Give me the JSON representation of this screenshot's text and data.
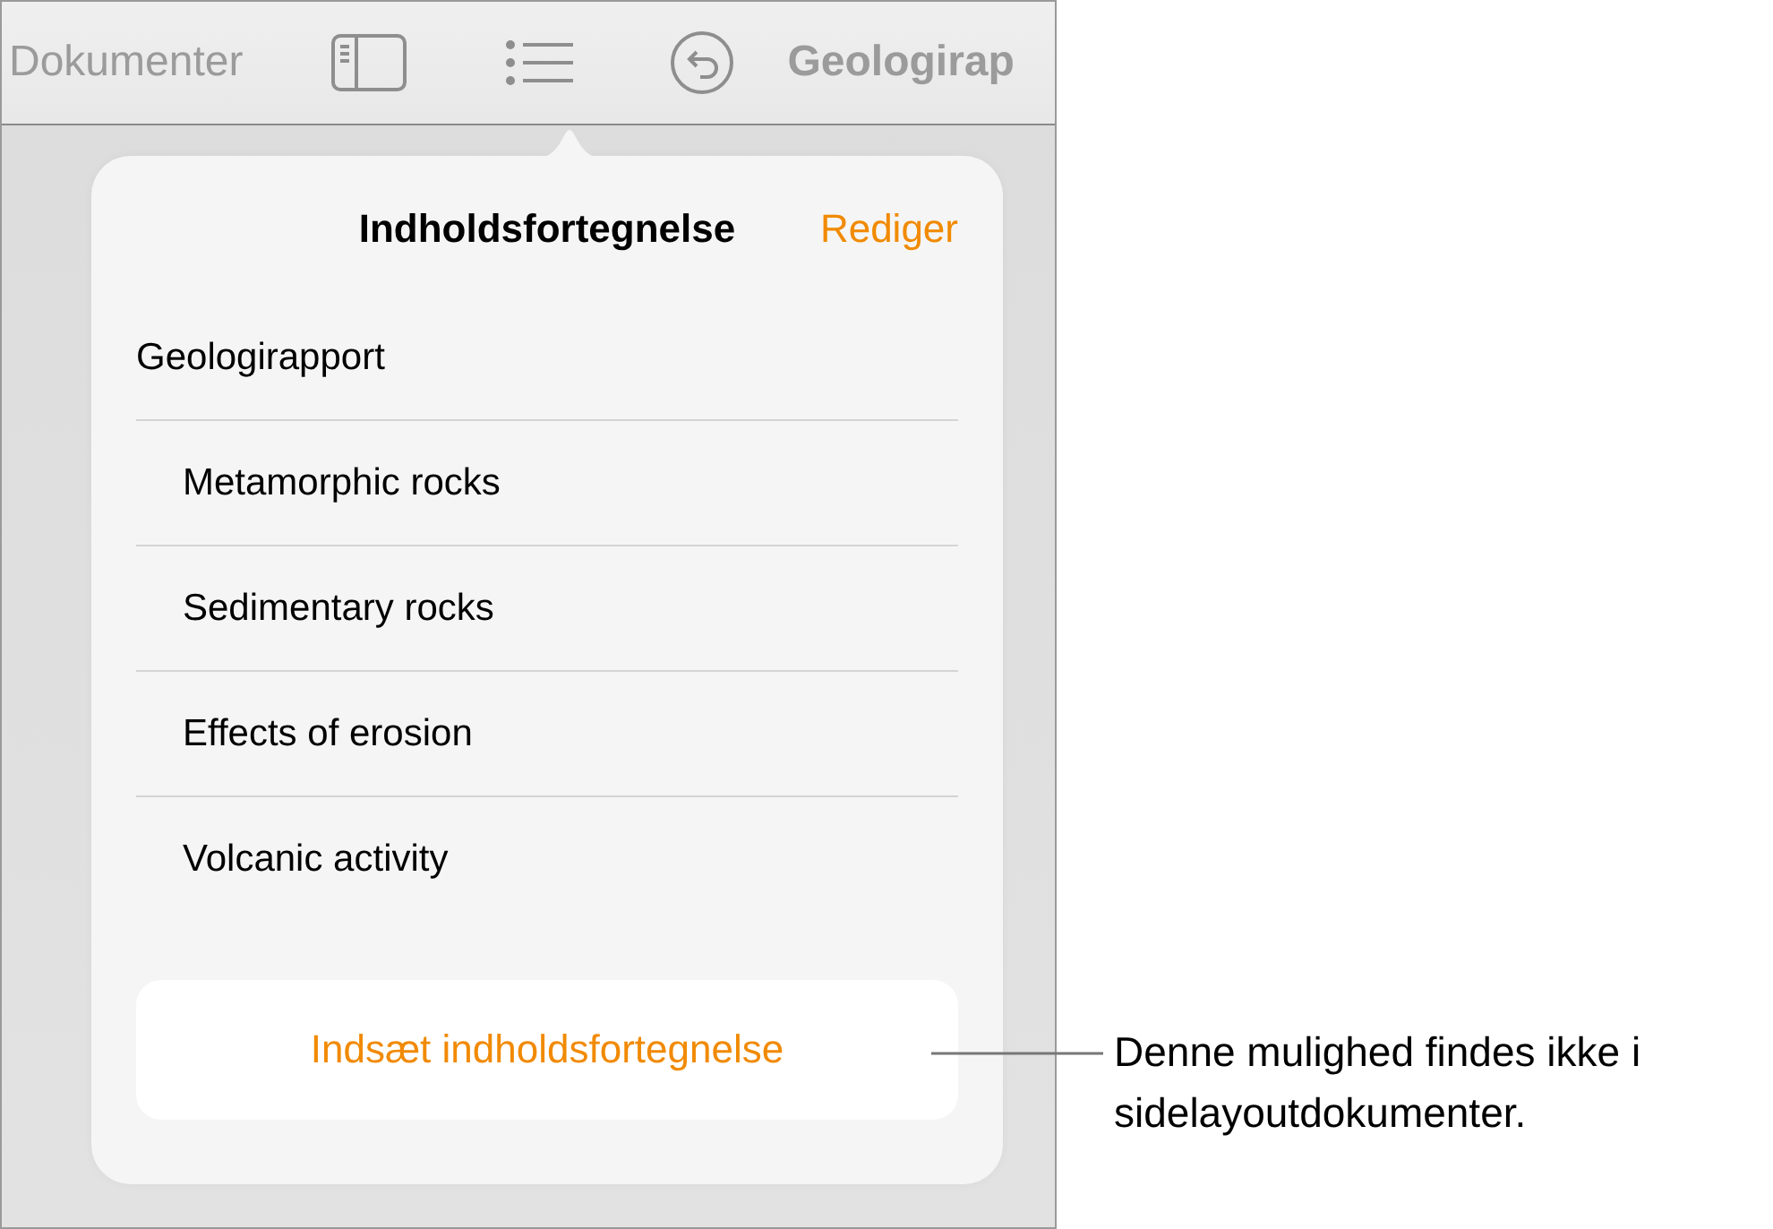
{
  "toolbar": {
    "back_label": "Dokumenter",
    "document_title": "Geologirap"
  },
  "popover": {
    "title": "Indholdsfortegnelse",
    "edit_label": "Rediger",
    "toc": [
      {
        "label": "Geologirapport",
        "children": [
          {
            "label": "Metamorphic rocks"
          },
          {
            "label": "Sedimentary rocks"
          },
          {
            "label": "Effects of erosion"
          },
          {
            "label": "Volcanic activity"
          }
        ]
      }
    ],
    "insert_button": "Indsæt indholdsfortegnelse"
  },
  "callout": {
    "text": "Denne mulighed findes ikke i sidelayoutdokumenter."
  }
}
